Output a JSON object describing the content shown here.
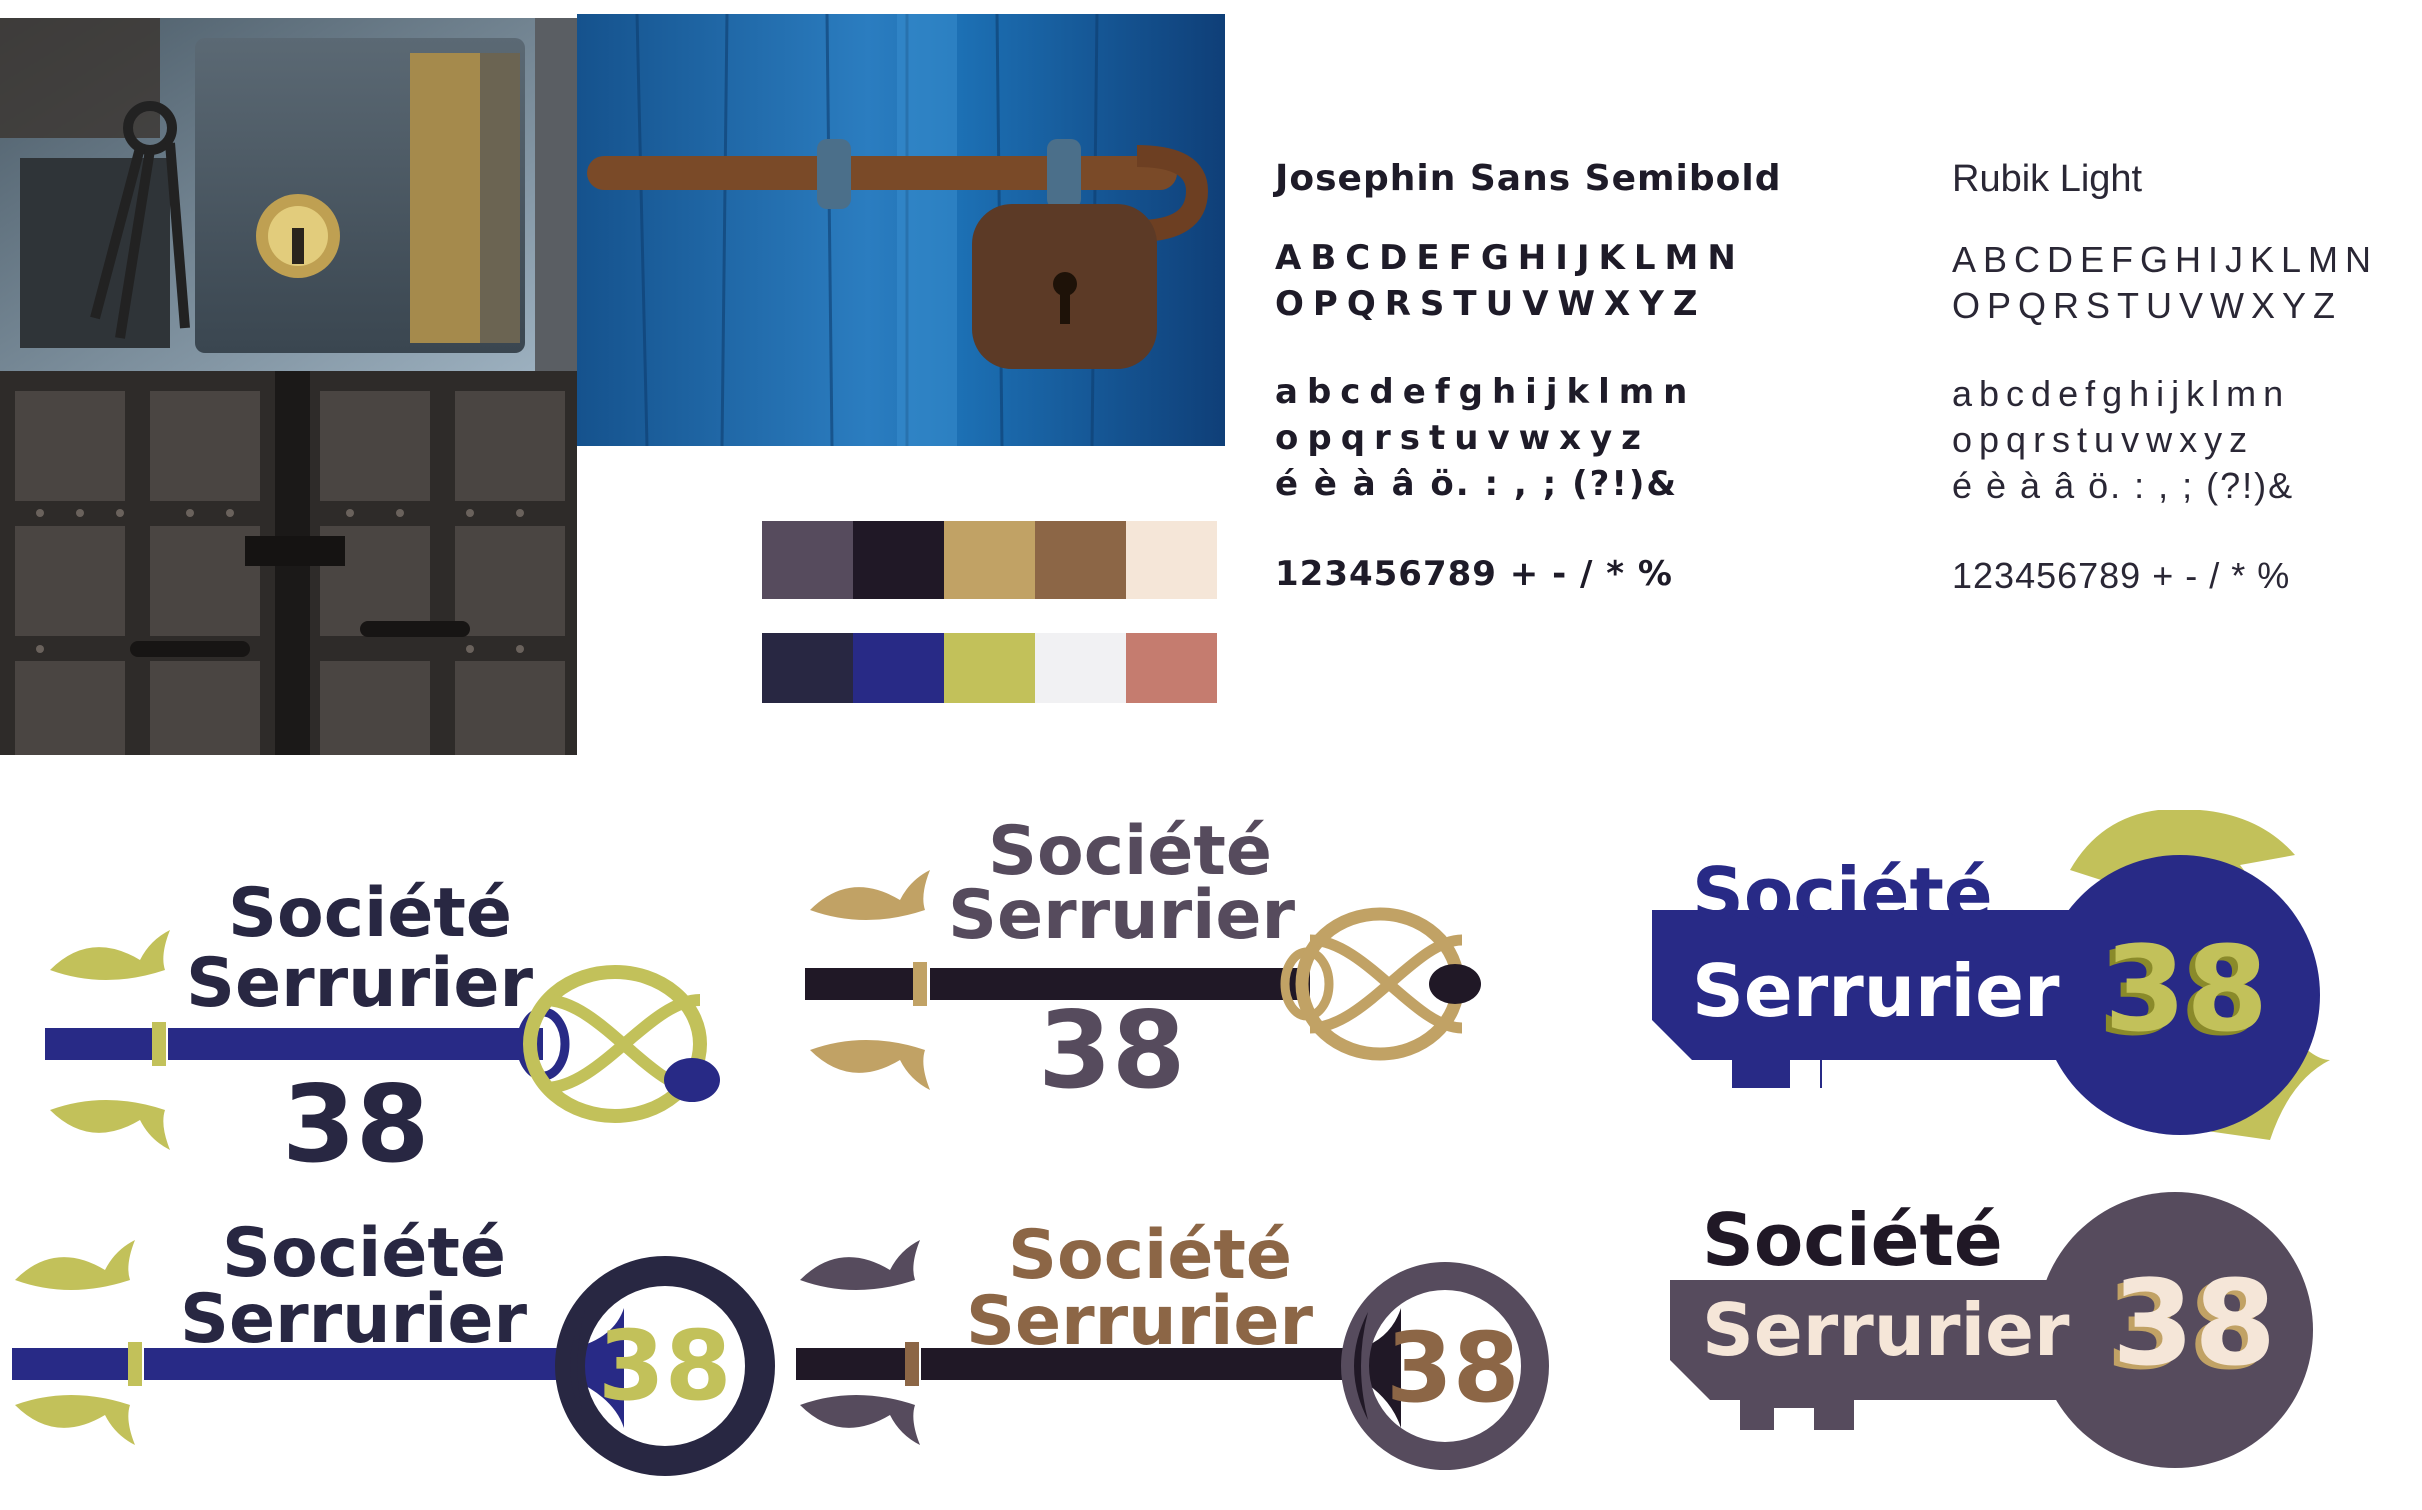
{
  "colors": {
    "palette_row_1": [
      "#564b5d",
      "#201826",
      "#c1a265",
      "#8c6646",
      "#f5e6d8"
    ],
    "palette_row_2": [
      "#282742",
      "#282a86",
      "#c2c15a",
      "#f1f1f3",
      "#c57c6f"
    ],
    "navy": "#282a86",
    "olive": "#c2c15a",
    "dark": "#201826",
    "plum": "#564b5d",
    "gold": "#c1a265",
    "brown": "#8c6646",
    "cream": "#f5e6d8"
  },
  "photos": {
    "lock_box": "old-door-lock-photo",
    "door_bolt": "blue-door-padlock-photo",
    "iron_door": "studded-iron-door-photo"
  },
  "fonts": {
    "primary": {
      "name": "Josephin Sans Semibold",
      "uppercase_1": "ABCDEFGHIJKLMN",
      "uppercase_2": "OPQRSTUVWXYZ",
      "lowercase_1": "abcdefghijklmn",
      "lowercase_2": "opqrstuvwxyz",
      "specials": "é è à â ö. : , ; (?!)&",
      "numbers": "123456789 + - / * %"
    },
    "secondary": {
      "name": "Rubik Light",
      "uppercase_1": "ABCDEFGHIJKLMN",
      "uppercase_2": "OPQRSTUVWXYZ",
      "lowercase_1": "abcdefghijklmn",
      "lowercase_2": "opqrstuvwxyz",
      "specials": "é è à â ö. : , ; (?!)&",
      "numbers": "123456789 + - / * %"
    }
  },
  "logo": {
    "word1": "Société",
    "word2": "Serrurier",
    "number": "38"
  }
}
